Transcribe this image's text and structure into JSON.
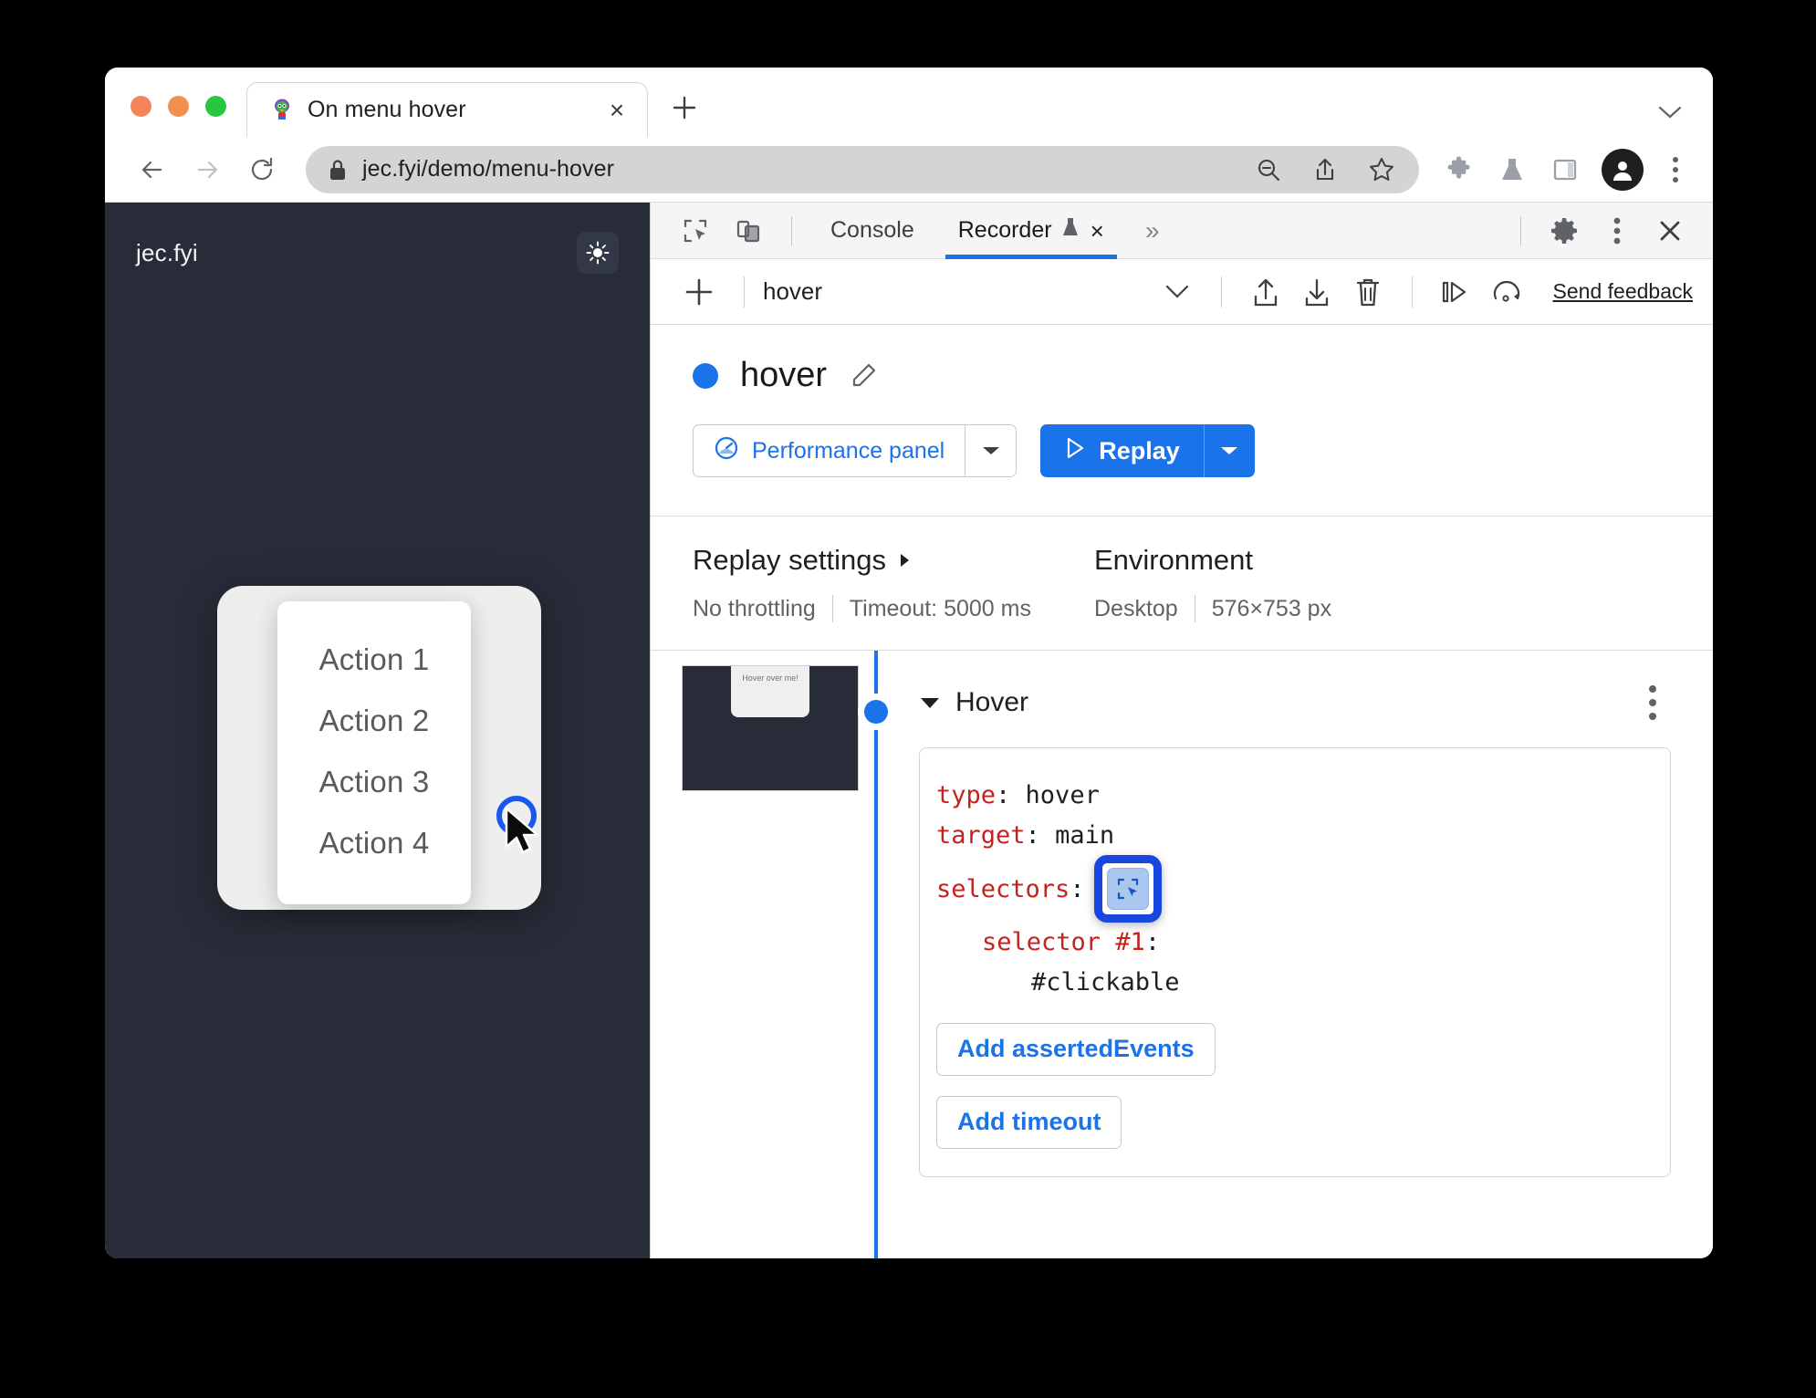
{
  "browser": {
    "tab": {
      "title": "On menu hover",
      "favicon": "parrot-favicon",
      "close_label": "×"
    },
    "new_tab_label": "+",
    "tabstrip_chevron": "chevron-down",
    "omnibox": {
      "url": "jec.fyi/demo/menu-hover",
      "lock": "lock-icon",
      "zoom_out": "zoom-out-icon",
      "share": "share-icon",
      "bookmark": "star-icon"
    },
    "toolbar_icons": [
      "extensions-puzzle-icon",
      "labs-flask-icon",
      "side-panel-icon"
    ],
    "profile": "avatar",
    "menu": "three-dot-menu"
  },
  "webpage": {
    "brand": "jec.fyi",
    "theme_toggle": "sun-icon",
    "card_text": "Hover over me!",
    "menu_items": [
      "Action 1",
      "Action 2",
      "Action 3",
      "Action 4"
    ],
    "cursor": "mouse-pointer"
  },
  "devtools": {
    "tabbar": {
      "inspect_icon": "inspect-element-icon",
      "device_icon": "device-toolbar-icon",
      "tabs": [
        {
          "label": "Console",
          "active": false
        },
        {
          "label": "Recorder",
          "active": true,
          "badge": "experimental-flask-icon",
          "close": "×"
        }
      ],
      "more_tabs": "»",
      "settings_icon": "gear-icon",
      "more_icon": "three-dot-menu",
      "close_icon": "close-icon"
    },
    "recorder_toolbar": {
      "add_label": "+",
      "recording_name": "hover",
      "dropdown": "chevron-down-icon",
      "import_icon": "import-icon",
      "export_icon": "export-icon",
      "delete_icon": "trash-icon",
      "step_by_step_icon": "step-by-step-icon",
      "replay_speed_icon": "replay-speed-icon",
      "feedback_label": "Send feedback"
    },
    "recording": {
      "status_dot_color": "#1a73e8",
      "title": "hover",
      "edit_icon": "pencil-icon",
      "performance_button": {
        "label": "Performance panel",
        "icon": "performance-icon",
        "split": "chevron-down-icon"
      },
      "replay_button": {
        "label": "Replay",
        "icon": "play-icon",
        "split": "chevron-down-icon"
      }
    },
    "replay_settings": {
      "title": "Replay settings",
      "expand_icon": "chevron-right-icon",
      "throttling": "No throttling",
      "timeout": "Timeout: 5000 ms"
    },
    "environment": {
      "title": "Environment",
      "device": "Desktop",
      "viewport": "576×753 px"
    },
    "steps": [
      {
        "thumbnail_text": "Hover over me!",
        "caret": "caret-down-icon",
        "name": "Hover",
        "kebab": "three-dot-menu",
        "code": [
          {
            "key": "type",
            "value": "hover",
            "indent": 0
          },
          {
            "key": "target",
            "value": "main",
            "indent": 0
          },
          {
            "key": "selectors",
            "value": "",
            "indent": 0,
            "chip": "selector-picker-icon",
            "highlighted": true
          },
          {
            "key": "selector #1",
            "value": "",
            "indent": 1
          },
          {
            "key": "",
            "value": "#clickable",
            "indent": 2
          }
        ],
        "buttons": [
          "Add assertedEvents",
          "Add timeout"
        ]
      }
    ]
  },
  "colors": {
    "accent_blue": "#1a73e8",
    "highlight_blue": "#1a46e0",
    "page_bg": "#272c38",
    "code_key_red": "#c5221f"
  }
}
